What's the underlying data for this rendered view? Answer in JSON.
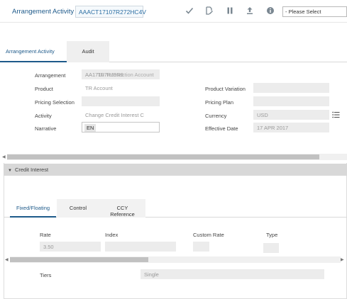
{
  "header": {
    "title": "Arrangement Activity",
    "reference": "AAACT17107R272HC4V",
    "select_value": "- Please Select",
    "icons": [
      "checkmark-icon",
      "edit-document-icon",
      "pause-icon",
      "upload-icon",
      "info-icon"
    ]
  },
  "tabs": [
    {
      "label": "Arrangement Activity",
      "active": true
    },
    {
      "label": "Audit",
      "active": false
    }
  ],
  "form": {
    "arrangement": {
      "label": "Arrangement",
      "value": "AA17107RJ9R9"
    },
    "arrangement_overlay": "TR Transaction Account",
    "product": {
      "label": "Product",
      "value": "TR Account"
    },
    "pricing_selection": {
      "label": "Pricing Selection",
      "value": ""
    },
    "activity": {
      "label": "Activity",
      "value": "Change Credit Interest C"
    },
    "narrative": {
      "label": "Narrative",
      "value": "EN"
    },
    "product_variation": {
      "label": "Product Variation",
      "value": ""
    },
    "pricing_plan": {
      "label": "Pricing Plan",
      "value": ""
    },
    "currency": {
      "label": "Currency",
      "value": "USD"
    },
    "effective_date": {
      "label": "Effective Date",
      "value": "17 APR 2017"
    }
  },
  "credit_interest": {
    "section_label": "Credit Interest",
    "tabs": [
      {
        "label": "Fixed/Floating",
        "active": true
      },
      {
        "label": "Control",
        "active": false
      },
      {
        "label": "CCY Reference",
        "active": false
      }
    ],
    "columns": [
      "Rate",
      "Index",
      "Custom Rate",
      "Type"
    ],
    "row": {
      "rate": "3.50",
      "index": "",
      "custom_rate": "",
      "type": ""
    },
    "tiers": {
      "label": "Tiers",
      "value": "Single"
    }
  },
  "colors": {
    "accent": "#1e5a8a",
    "field_bg": "#ececec",
    "section_header": "#d8d8d8"
  }
}
